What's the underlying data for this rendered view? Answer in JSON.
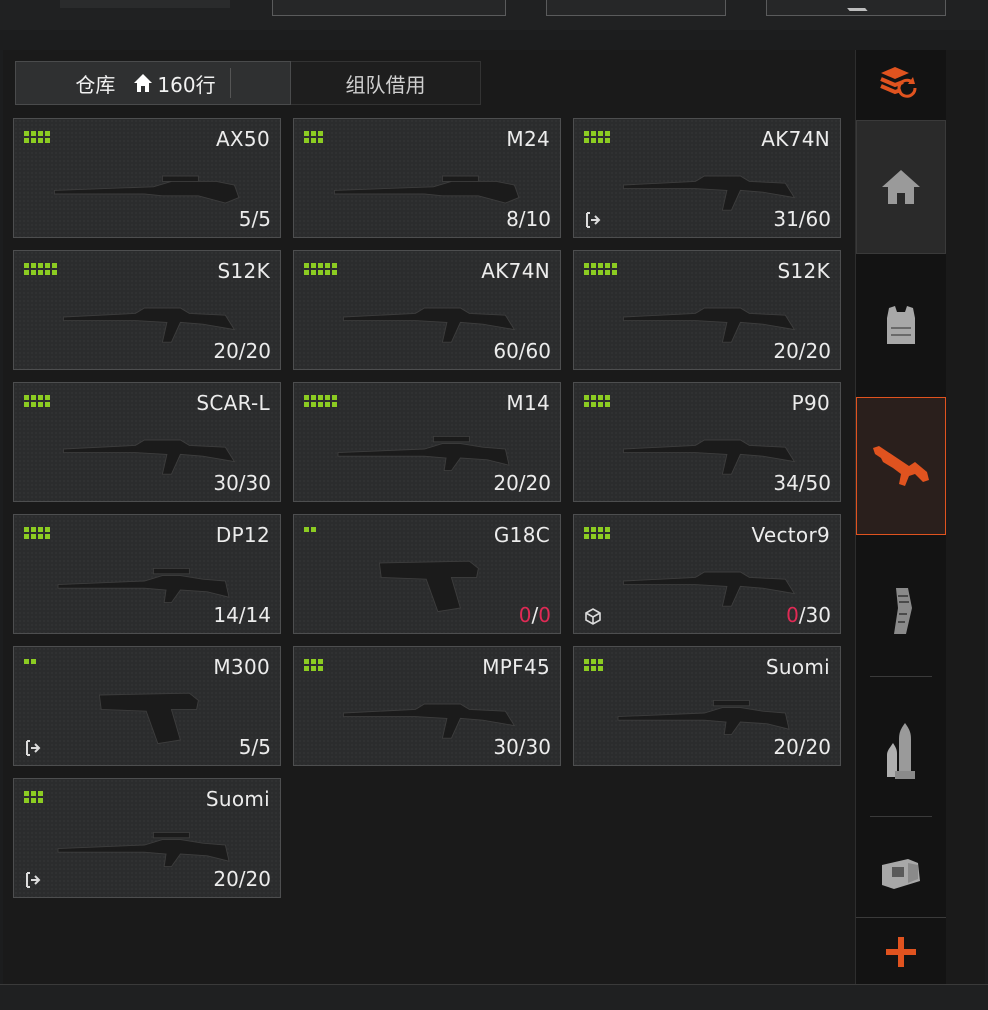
{
  "tabs": {
    "warehouse_label": "仓库",
    "warehouse_capacity": "160行",
    "team_borrow_label": "组队借用"
  },
  "colors": {
    "accent": "#e0531f",
    "dots": "#8ccc22",
    "ammo_empty": "#e02a55"
  },
  "weapons": [
    {
      "name": "AX50",
      "ammo_current": "5",
      "ammo_max": "5",
      "dots": 8,
      "badge": ""
    },
    {
      "name": "M24",
      "ammo_current": "8",
      "ammo_max": "10",
      "dots": 6,
      "badge": ""
    },
    {
      "name": "AK74N",
      "ammo_current": "31",
      "ammo_max": "60",
      "dots": 8,
      "badge": "transfer-icon"
    },
    {
      "name": "S12K",
      "ammo_current": "20",
      "ammo_max": "20",
      "dots": 10,
      "badge": ""
    },
    {
      "name": "AK74N",
      "ammo_current": "60",
      "ammo_max": "60",
      "dots": 10,
      "badge": ""
    },
    {
      "name": "S12K",
      "ammo_current": "20",
      "ammo_max": "20",
      "dots": 10,
      "badge": ""
    },
    {
      "name": "SCAR-L",
      "ammo_current": "30",
      "ammo_max": "30",
      "dots": 8,
      "badge": ""
    },
    {
      "name": "M14",
      "ammo_current": "20",
      "ammo_max": "20",
      "dots": 10,
      "badge": ""
    },
    {
      "name": "P90",
      "ammo_current": "34",
      "ammo_max": "50",
      "dots": 8,
      "badge": ""
    },
    {
      "name": "DP12",
      "ammo_current": "14",
      "ammo_max": "14",
      "dots": 8,
      "badge": ""
    },
    {
      "name": "G18C",
      "ammo_current": "0",
      "ammo_max": "0",
      "dots": 2,
      "badge": "",
      "empty": true,
      "max_empty": true
    },
    {
      "name": "Vector9",
      "ammo_current": "0",
      "ammo_max": "30",
      "dots": 8,
      "badge": "box-icon",
      "empty": true
    },
    {
      "name": "M300",
      "ammo_current": "5",
      "ammo_max": "5",
      "dots": 2,
      "badge": "transfer-icon"
    },
    {
      "name": "MPF45",
      "ammo_current": "30",
      "ammo_max": "30",
      "dots": 6,
      "badge": ""
    },
    {
      "name": "Suomi",
      "ammo_current": "20",
      "ammo_max": "20",
      "dots": 6,
      "badge": ""
    },
    {
      "name": "Suomi",
      "ammo_current": "20",
      "ammo_max": "20",
      "dots": 6,
      "badge": "transfer-icon"
    }
  ],
  "sidebar": {
    "items": [
      {
        "icon": "stack-refresh-icon"
      },
      {
        "icon": "home-icon"
      },
      {
        "icon": "vest-icon"
      },
      {
        "icon": "rifle-icon",
        "active": true
      },
      {
        "icon": "magazine-icon"
      },
      {
        "icon": "ammo-icon"
      },
      {
        "icon": "sight-icon"
      },
      {
        "icon": "add-icon"
      }
    ]
  }
}
